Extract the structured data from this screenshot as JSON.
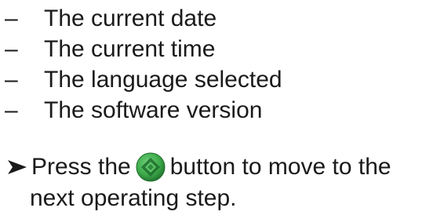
{
  "bullets": [
    {
      "dash": "–",
      "text": "The current date"
    },
    {
      "dash": "–",
      "text": "The current time"
    },
    {
      "dash": "–",
      "text": "The language selected"
    },
    {
      "dash": "–",
      "text": "The software version"
    }
  ],
  "instruction": {
    "icon": "arrowhead-bullet-icon",
    "before": "Press the",
    "button_icon": "green-start-button-icon",
    "after": "button to move to the",
    "line2": "next operating step."
  },
  "colors": {
    "text": "#1a1a1a",
    "button_green": "#3daa4a",
    "button_dark": "#1f6d2c"
  }
}
